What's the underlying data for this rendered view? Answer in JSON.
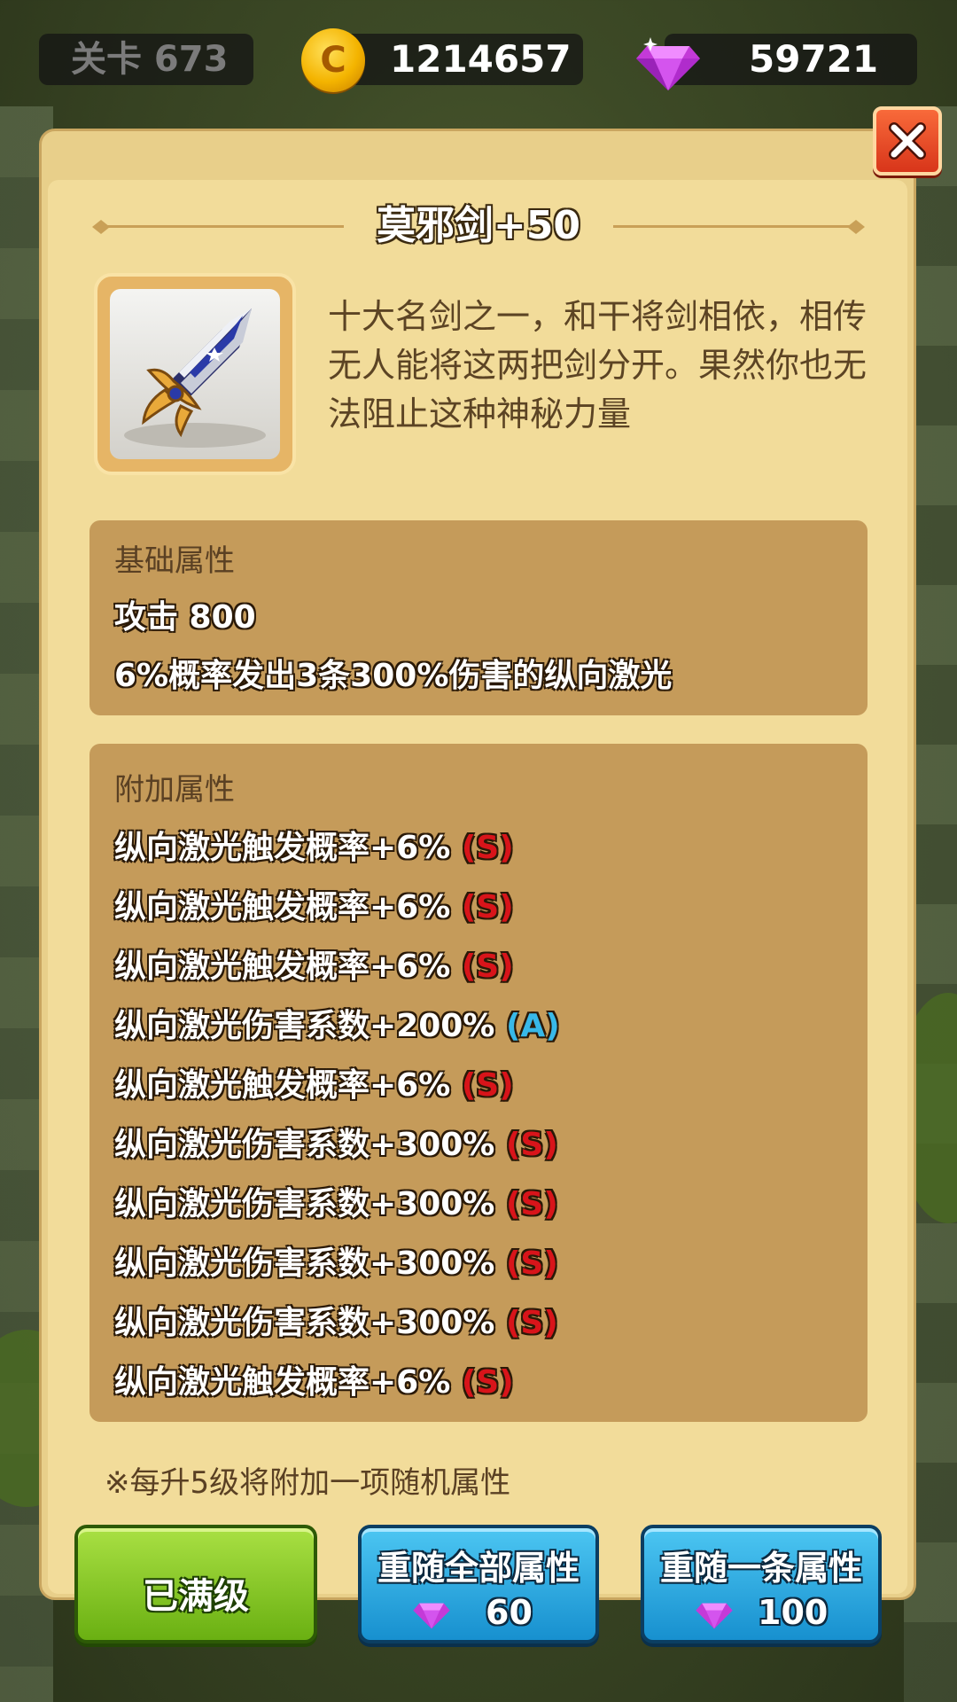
{
  "topbar": {
    "level_label": "关卡 673",
    "coins": "1214657",
    "gems": "59721"
  },
  "item": {
    "title": "莫邪剑+50",
    "description": "十大名剑之一，和干将剑相依，相传无人能将这两把剑分开。果然你也无法阻止这种神秘力量",
    "icon": "sword-icon"
  },
  "base_attributes": {
    "header": "基础属性",
    "lines": [
      "攻击 800",
      "6%概率发出3条300%伤害的纵向激光"
    ]
  },
  "extra_attributes": {
    "header": "附加属性",
    "lines": [
      {
        "text": "纵向激光触发概率+6%",
        "grade": "(S)"
      },
      {
        "text": "纵向激光触发概率+6%",
        "grade": "(S)"
      },
      {
        "text": "纵向激光触发概率+6%",
        "grade": "(S)"
      },
      {
        "text": "纵向激光伤害系数+200%",
        "grade": "(A)"
      },
      {
        "text": "纵向激光触发概率+6%",
        "grade": "(S)"
      },
      {
        "text": "纵向激光伤害系数+300%",
        "grade": "(S)"
      },
      {
        "text": "纵向激光伤害系数+300%",
        "grade": "(S)"
      },
      {
        "text": "纵向激光伤害系数+300%",
        "grade": "(S)"
      },
      {
        "text": "纵向激光伤害系数+300%",
        "grade": "(S)"
      },
      {
        "text": "纵向激光触发概率+6%",
        "grade": "(S)"
      }
    ]
  },
  "note": "※每升5级将附加一项随机属性",
  "buttons": {
    "max_level": "已满级",
    "reroll_all": {
      "label": "重随全部属性",
      "cost": "60"
    },
    "reroll_one": {
      "label": "重随一条属性",
      "cost": "100"
    }
  },
  "colors": {
    "grade_s": "#d8141a",
    "grade_a": "#38b8e8",
    "panel": "#f2dc9a",
    "attr_box": "#c59b5a"
  }
}
